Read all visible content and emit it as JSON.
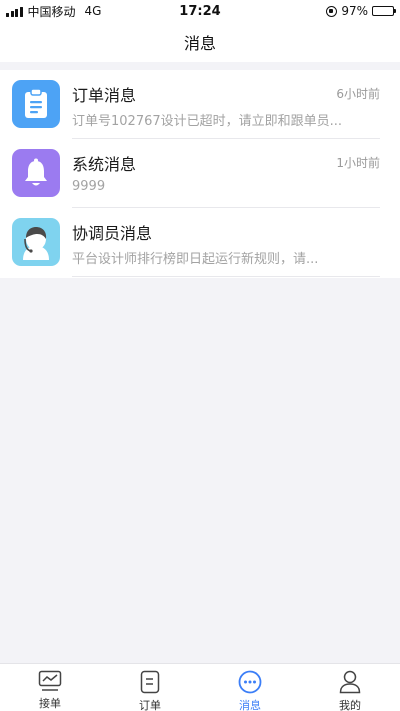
{
  "status_bar": {
    "carrier": "中国移动",
    "network": "4G",
    "time": "17:24",
    "battery": "97%",
    "battery_level": 0.97
  },
  "nav": {
    "title": "消息"
  },
  "messages": [
    {
      "title": "订单消息",
      "time": "6小时前",
      "preview": "订单号102767设计已超时，请立即和跟单员...",
      "icon": "clipboard-icon",
      "color": "#4da3f5"
    },
    {
      "title": "系统消息",
      "time": "1小时前",
      "preview": "9999",
      "icon": "bell-icon",
      "color": "#9b7bf0"
    },
    {
      "title": "协调员消息",
      "time": "",
      "preview": "平台设计师排行榜即日起运行新规则，请...",
      "icon": "coordinator-avatar-icon",
      "color": "#7fd3ef"
    }
  ],
  "tabs": [
    {
      "label": "接单",
      "icon": "chart-board-icon",
      "active": false
    },
    {
      "label": "订单",
      "icon": "document-icon",
      "active": false
    },
    {
      "label": "消息",
      "icon": "chat-bubble-icon",
      "active": true
    },
    {
      "label": "我的",
      "icon": "user-icon",
      "active": false
    }
  ],
  "colors": {
    "accent": "#3b7ef7",
    "background": "#f3f3f7"
  }
}
